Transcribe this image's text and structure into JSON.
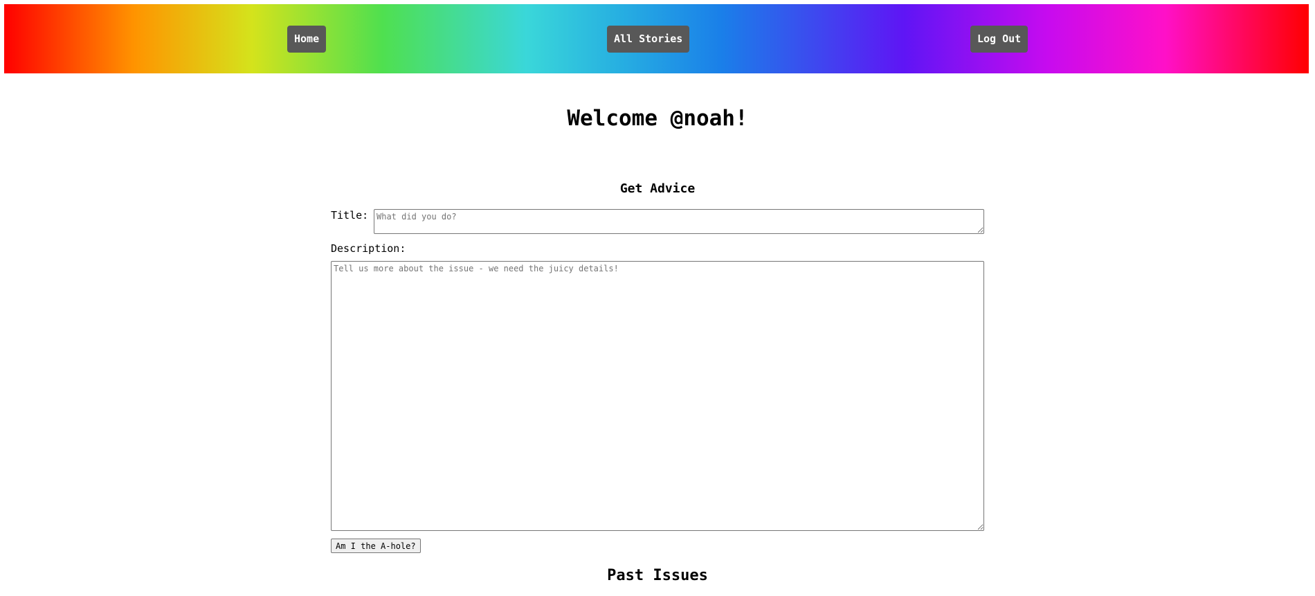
{
  "nav": {
    "home_label": "Home",
    "stories_label": "All Stories",
    "logout_label": "Log Out"
  },
  "welcome_text": "Welcome @noah!",
  "form": {
    "heading": "Get Advice",
    "title_label": "Title:",
    "title_placeholder": "What did you do?",
    "description_label": "Description:",
    "description_placeholder": "Tell us more about the issue - we need the juicy details!",
    "submit_label": "Am I the A-hole?"
  },
  "past_issues_heading": "Past Issues",
  "colors": {
    "nav_button_bg": "#585858",
    "nav_button_text": "#ffffff"
  }
}
